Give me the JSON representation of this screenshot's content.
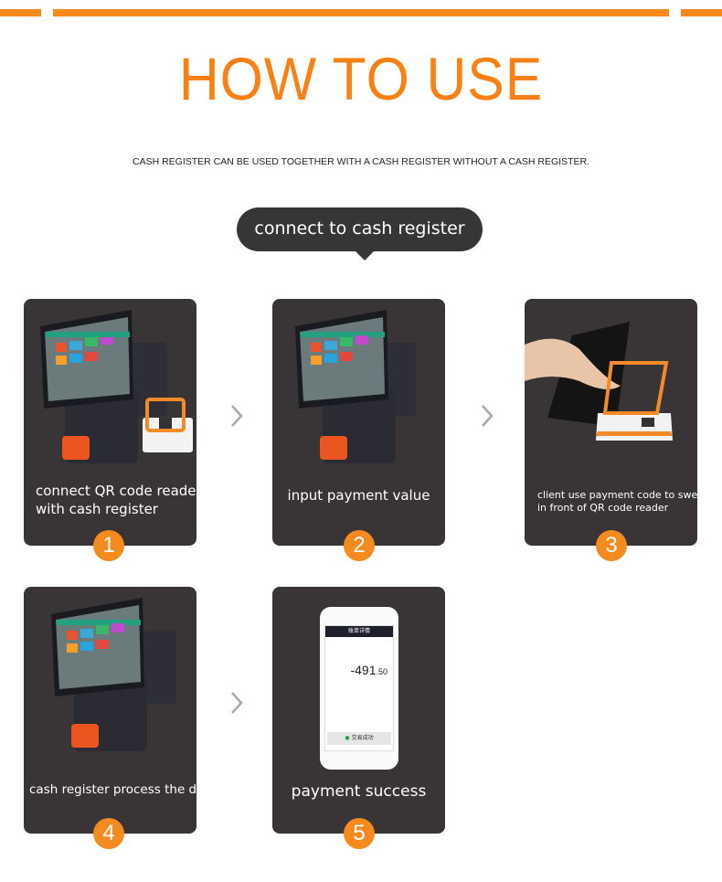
{
  "page": {
    "title": "HOW TO USE",
    "subtitle": "CASH REGISTER CAN BE USED TOGETHER WITH A CASH REGISTER WITHOUT A CASH REGISTER.",
    "section_label": "connect to cash register",
    "accent_color": "#fb8a1c",
    "card_color": "#393536"
  },
  "steps": [
    {
      "number": "1",
      "caption_line1": "connect QR code reader",
      "caption_line2": "with cash register",
      "illustration": "pos-terminal-with-qr-reader"
    },
    {
      "number": "2",
      "caption_line1": "input payment value",
      "caption_line2": "",
      "illustration": "pos-terminal"
    },
    {
      "number": "3",
      "caption_line1": "client use payment code to sweep",
      "caption_line2": "in front of QR code reader",
      "illustration": "hand-phone-qr-reader"
    },
    {
      "number": "4",
      "caption_line1": "cash register process the deal",
      "caption_line2": "",
      "illustration": "pos-terminal"
    },
    {
      "number": "5",
      "caption_line1": "payment success",
      "caption_line2": "",
      "illustration": "phone-payment-receipt"
    }
  ],
  "phone_receipt": {
    "amount": "-491",
    "amount_decimal": ".50",
    "status": "交易成功",
    "header": "账单详情"
  },
  "arrows": [
    "chevron-right-icon",
    "chevron-right-icon",
    "chevron-right-icon"
  ]
}
